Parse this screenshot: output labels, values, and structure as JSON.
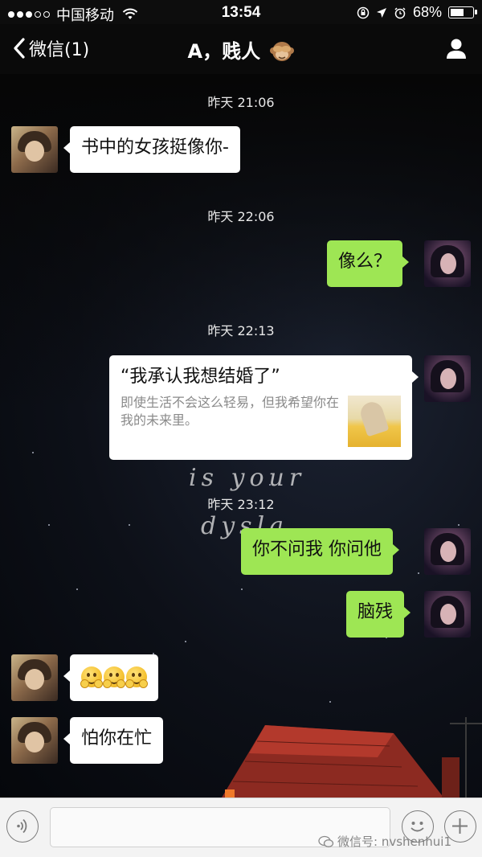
{
  "status_bar": {
    "carrier": "中国移动",
    "time": "13:54",
    "battery_percent": "68%",
    "battery_level": 0.68
  },
  "nav": {
    "back_label": "微信(1)",
    "title": "A，贱人"
  },
  "messages": [
    {
      "type": "timestamp",
      "text": "昨天 21:06"
    },
    {
      "type": "text",
      "side": "left",
      "text": "书中的女孩挺像你-"
    },
    {
      "type": "timestamp",
      "text": "昨天 22:06"
    },
    {
      "type": "text",
      "side": "right",
      "text": "像么？"
    },
    {
      "type": "timestamp",
      "text": "昨天 22:13"
    },
    {
      "type": "link",
      "side": "right",
      "title": "“我承认我想结婚了”",
      "description": "即使生活不会这么轻易，但我希望你在我的未来里。"
    },
    {
      "type": "timestamp",
      "text": "昨天 23:12"
    },
    {
      "type": "text",
      "side": "right",
      "text": "你不问我  你问他"
    },
    {
      "type": "text",
      "side": "right",
      "text": "脑残"
    },
    {
      "type": "emoji",
      "side": "left",
      "emoji": "hugging-face",
      "count": 3
    },
    {
      "type": "text",
      "side": "left",
      "text": "怕你在忙"
    }
  ],
  "background_text": [
    "is your",
    "dysla"
  ],
  "watermark": "微信号: nvshenhui1",
  "colors": {
    "sent_bubble": "#9ee654",
    "received_bubble": "#ffffff",
    "nav_bg": "#0a0a0a"
  }
}
